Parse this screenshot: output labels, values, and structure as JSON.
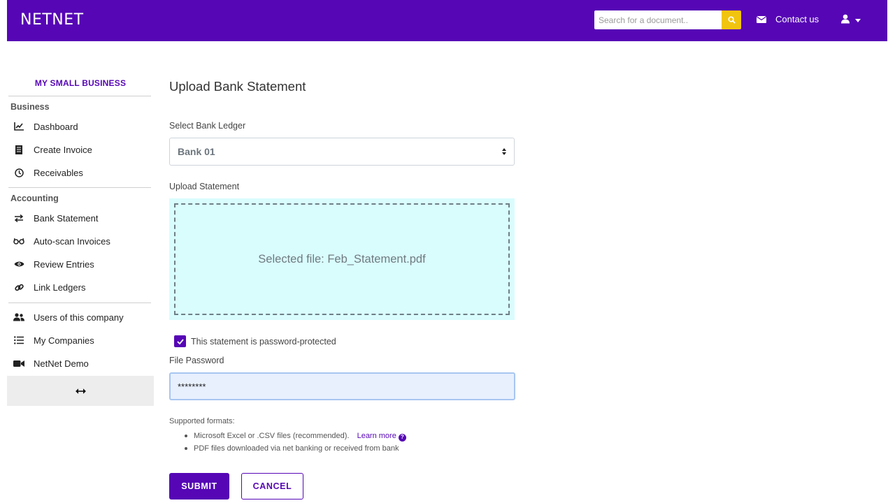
{
  "header": {
    "brand": "NETNET",
    "search_placeholder": "Search for a document..",
    "search_icon": "search-icon",
    "contact_label": "Contact us",
    "contact_icon": "envelope-icon",
    "user_icon": "user-icon"
  },
  "sidebar": {
    "company": "MY SMALL BUSINESS",
    "sections": [
      {
        "title": "Business",
        "items": [
          {
            "label": "Dashboard",
            "icon": "chart-line-icon"
          },
          {
            "label": "Create Invoice",
            "icon": "receipt-icon"
          },
          {
            "label": "Receivables",
            "icon": "clock-icon"
          }
        ]
      },
      {
        "title": "Accounting",
        "items": [
          {
            "label": "Bank Statement",
            "icon": "exchange-icon"
          },
          {
            "label": "Auto-scan Invoices",
            "icon": "glasses-icon"
          },
          {
            "label": "Review Entries",
            "icon": "eye-icon"
          },
          {
            "label": "Link Ledgers",
            "icon": "link-icon"
          }
        ]
      },
      {
        "title": "",
        "items": [
          {
            "label": "Users of this company",
            "icon": "users-icon"
          },
          {
            "label": "My Companies",
            "icon": "list-icon"
          },
          {
            "label": "NetNet Demo",
            "icon": "video-icon"
          }
        ]
      }
    ],
    "collapse_icon": "arrows-horizontal-icon"
  },
  "main": {
    "title": "Upload Bank Statement",
    "ledger_label": "Select Bank Ledger",
    "ledger_value": "Bank 01",
    "upload_label": "Upload Statement",
    "dropzone_text": "Selected file: Feb_Statement.pdf",
    "password_checkbox_label": "This statement is password-protected",
    "password_checked": true,
    "password_label": "File Password",
    "password_value": "********",
    "formats_title": "Supported formats:",
    "formats": [
      "Microsoft Excel or .CSV files (recommended).",
      "PDF files downloaded via net banking or received from bank"
    ],
    "learn_more": "Learn more",
    "submit_label": "SUBMIT",
    "cancel_label": "CANCEL"
  },
  "colors": {
    "brand": "#5606b5",
    "search_button": "#f1c40f",
    "dropzone_bg": "#d9fcfd"
  }
}
